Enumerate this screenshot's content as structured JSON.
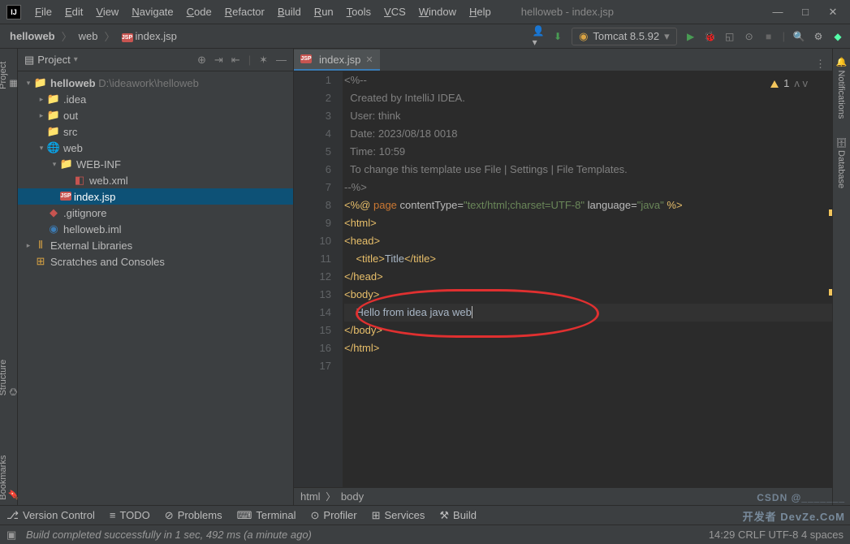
{
  "window_title": "helloweb - index.jsp",
  "menu": [
    "File",
    "Edit",
    "View",
    "Navigate",
    "Code",
    "Refactor",
    "Build",
    "Run",
    "Tools",
    "VCS",
    "Window",
    "Help"
  ],
  "breadcrumb": [
    "helloweb",
    "web",
    "index.jsp"
  ],
  "run_config": "Tomcat 8.5.92",
  "project_label": "Project",
  "tree": {
    "root": {
      "name": "helloweb",
      "path": "D:\\ideawork\\helloweb"
    },
    "idea": ".idea",
    "out": "out",
    "src": "src",
    "web": "web",
    "webinf": "WEB-INF",
    "webxml": "web.xml",
    "indexjsp": "index.jsp",
    "gitignore": ".gitignore",
    "iml": "helloweb.iml",
    "extlib": "External Libraries",
    "scratches": "Scratches and Consoles"
  },
  "tab": {
    "label": "index.jsp"
  },
  "warn_count": "1",
  "code_lines": [
    {
      "n": 1,
      "html": "<span class='c-comment'>&lt;%--</span>"
    },
    {
      "n": 2,
      "html": "<span class='c-comment'>  Created by IntelliJ IDEA.</span>"
    },
    {
      "n": 3,
      "html": "<span class='c-comment'>  User: think</span>"
    },
    {
      "n": 4,
      "html": "<span class='c-comment'>  Date: 2023/08/18 0018</span>"
    },
    {
      "n": 5,
      "html": "<span class='c-comment'>  Time: 10:59</span>"
    },
    {
      "n": 6,
      "html": "<span class='c-comment'>  To change this template use File | Settings | File Templates.</span>"
    },
    {
      "n": 7,
      "html": "<span class='c-comment'>--%&gt;</span>"
    },
    {
      "n": 8,
      "html": "<span class='c-tag'>&lt;%@</span> <span class='c-kw'>page</span> <span class='c-attr'>contentType=</span><span class='c-str'>\"text/html;charset=UTF-8\"</span> <span class='c-attr'>language=</span><span class='c-str'>\"java\"</span> <span class='c-tag'>%&gt;</span>"
    },
    {
      "n": 9,
      "html": "<span class='c-tag'>&lt;html&gt;</span>"
    },
    {
      "n": 10,
      "html": "<span class='c-tag'>&lt;head&gt;</span>"
    },
    {
      "n": 11,
      "html": "    <span class='c-tag'>&lt;title&gt;</span>Title<span class='c-tag'>&lt;/title&gt;</span>"
    },
    {
      "n": 12,
      "html": "<span class='c-tag'>&lt;/head&gt;</span>"
    },
    {
      "n": 13,
      "html": "<span class='c-tag'>&lt;body&gt;</span>"
    },
    {
      "n": 14,
      "html": "    Hello from idea java web<span style='border-left:1px solid #bbb;'></span>",
      "cur": true
    },
    {
      "n": 15,
      "html": "<span class='c-tag'>&lt;/body&gt;</span>"
    },
    {
      "n": 16,
      "html": "<span class='c-tag'>&lt;/html&gt;</span>"
    },
    {
      "n": 17,
      "html": ""
    }
  ],
  "editor_breadcrumb": [
    "html",
    "body"
  ],
  "bottom_tools": [
    "Version Control",
    "TODO",
    "Problems",
    "Terminal",
    "Profiler",
    "Services",
    "Build"
  ],
  "status_msg": "Build completed successfully in 1 sec, 492 ms (a minute ago)",
  "status_right": "14:29   CRLF   UTF-8   4 spaces",
  "watermark_sub": "CSDN @_______",
  "watermark": "开发者 DevZe.CoM"
}
